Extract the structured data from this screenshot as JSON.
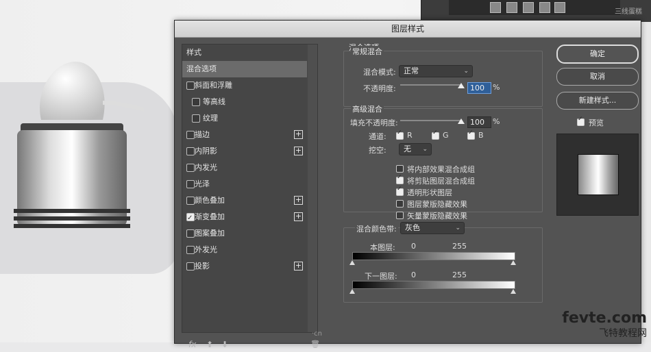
{
  "dialog": {
    "title": "图层样式"
  },
  "background": {
    "panel_title": "三线蛋糕"
  },
  "left": {
    "header": "样式",
    "items": [
      {
        "label": "混合选项",
        "checkbox": false,
        "checked": false,
        "plus": false,
        "selected": true,
        "indent": false
      },
      {
        "label": "斜面和浮雕",
        "checkbox": true,
        "checked": false,
        "plus": false,
        "selected": false,
        "indent": false
      },
      {
        "label": "等高线",
        "checkbox": true,
        "checked": false,
        "plus": false,
        "selected": false,
        "indent": true
      },
      {
        "label": "纹理",
        "checkbox": true,
        "checked": false,
        "plus": false,
        "selected": false,
        "indent": true
      },
      {
        "label": "描边",
        "checkbox": true,
        "checked": false,
        "plus": true,
        "selected": false,
        "indent": false
      },
      {
        "label": "内阴影",
        "checkbox": true,
        "checked": false,
        "plus": true,
        "selected": false,
        "indent": false
      },
      {
        "label": "内发光",
        "checkbox": true,
        "checked": false,
        "plus": false,
        "selected": false,
        "indent": false
      },
      {
        "label": "光泽",
        "checkbox": true,
        "checked": false,
        "plus": false,
        "selected": false,
        "indent": false
      },
      {
        "label": "颜色叠加",
        "checkbox": true,
        "checked": false,
        "plus": true,
        "selected": false,
        "indent": false
      },
      {
        "label": "渐变叠加",
        "checkbox": true,
        "checked": true,
        "plus": true,
        "selected": false,
        "indent": false
      },
      {
        "label": "图案叠加",
        "checkbox": true,
        "checked": false,
        "plus": false,
        "selected": false,
        "indent": false
      },
      {
        "label": "外发光",
        "checkbox": true,
        "checked": false,
        "plus": false,
        "selected": false,
        "indent": false
      },
      {
        "label": "投影",
        "checkbox": true,
        "checked": false,
        "plus": true,
        "selected": false,
        "indent": false
      }
    ],
    "footer": {
      "fx": "fx",
      "up": "⬆",
      "down": "⬇",
      "trash": "🗑"
    }
  },
  "blend": {
    "section_title": "混合选项",
    "general": {
      "title": "常规混合",
      "mode_label": "混合模式:",
      "mode_value": "正常",
      "opacity_label": "不透明度:",
      "opacity_value": "100",
      "percent": "%"
    },
    "advanced": {
      "title": "高级混合",
      "fill_label": "填充不透明度:",
      "fill_value": "100",
      "percent": "%",
      "channels_label": "通道:",
      "channels": [
        "R",
        "G",
        "B"
      ],
      "knockout_label": "挖空:",
      "knockout_value": "无",
      "options": [
        {
          "label": "将内部效果混合成组",
          "checked": false
        },
        {
          "label": "将剪贴图层混合成组",
          "checked": true
        },
        {
          "label": "透明形状图层",
          "checked": true
        },
        {
          "label": "图层蒙版隐藏效果",
          "checked": false
        },
        {
          "label": "矢量蒙版隐藏效果",
          "checked": false
        }
      ]
    },
    "blend_if": {
      "label": "混合颜色带:",
      "value": "灰色",
      "this_layer": "本图层:",
      "under_layer": "下一图层:",
      "min": "0",
      "max": "255"
    }
  },
  "buttons": {
    "ok": "确定",
    "cancel": "取消",
    "new_style": "新建样式...",
    "preview": "预览"
  },
  "watermark": {
    "line1": "fevte.com",
    "line2": "飞特教程网",
    "cn": "·cn"
  }
}
